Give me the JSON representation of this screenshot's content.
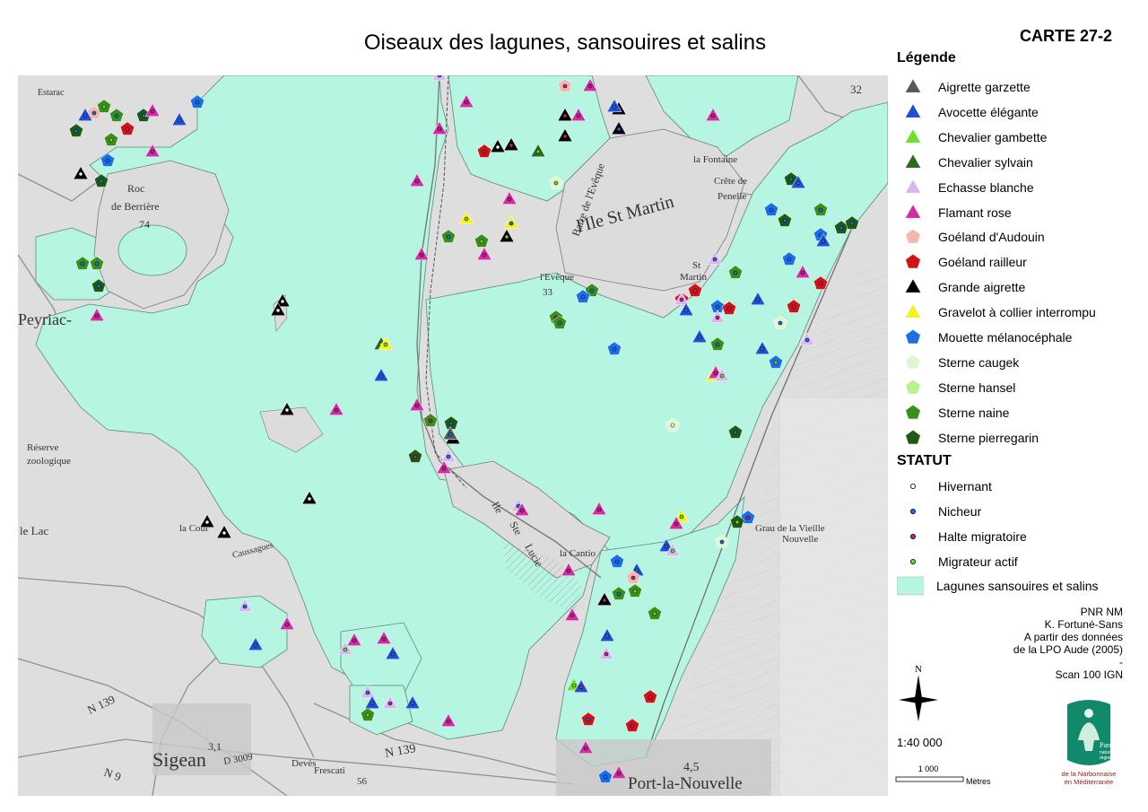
{
  "header": {
    "title": "Oiseaux des lagunes, sansouires et salins",
    "map_id": "CARTE 27-2"
  },
  "colors": {
    "lagoon": "#b5f5e2",
    "land": "#dcdcdc",
    "road": "#8a8a8a"
  },
  "legend": {
    "title": "Légende",
    "species": [
      {
        "label": "Aigrette garzette",
        "shape": "triangle",
        "color": "#595959"
      },
      {
        "label": "Avocette élégante",
        "shape": "triangle",
        "color": "#1f4fd6"
      },
      {
        "label": "Chevalier gambette",
        "shape": "triangle",
        "color": "#6ee028"
      },
      {
        "label": "Chevalier sylvain",
        "shape": "triangle",
        "color": "#2b6a1c"
      },
      {
        "label": "Echasse blanche",
        "shape": "triangle",
        "color": "#d8b6f0"
      },
      {
        "label": "Flamant rose",
        "shape": "triangle",
        "color": "#d02fa4"
      },
      {
        "label": "Goéland d'Audouin",
        "shape": "pentagon",
        "color": "#f2b8b0"
      },
      {
        "label": "Goéland railleur",
        "shape": "pentagon",
        "color": "#d01414"
      },
      {
        "label": "Grande aigrette",
        "shape": "triangle",
        "color": "#000000"
      },
      {
        "label": "Gravelot à collier interrompu",
        "shape": "triangle",
        "color": "#f5f01e"
      },
      {
        "label": "Mouette mélanocéphale",
        "shape": "pentagon",
        "color": "#1a6ee8"
      },
      {
        "label": "Sterne caugek",
        "shape": "pentagon",
        "color": "#dff7cf"
      },
      {
        "label": "Sterne hansel",
        "shape": "pentagon",
        "color": "#b8f28c"
      },
      {
        "label": "Sterne naine",
        "shape": "pentagon",
        "color": "#3a8f1a"
      },
      {
        "label": "Sterne pierregarin",
        "shape": "pentagon",
        "color": "#1f5a14"
      }
    ],
    "status_title": "STATUT",
    "status": [
      {
        "label": "Hivernant",
        "color": "#ffffff"
      },
      {
        "label": "Nicheur",
        "color": "#1a6ee8"
      },
      {
        "label": "Halte migratoire",
        "color": "#c0208a"
      },
      {
        "label": "Migrateur actif",
        "color": "#6ee028"
      }
    ],
    "area_label": "Lagunes sansouires et salins"
  },
  "credits": [
    "PNR NM",
    "K. Fortuné-Sans",
    "A partir des données",
    "de la LPO Aude (2005)",
    "-",
    "Scan 100 IGN"
  ],
  "scale": {
    "ratio": "1:40 000",
    "bar_value": "1 000",
    "bar_unit": "Mètres"
  },
  "north_label": "N",
  "logo": {
    "line1": "Parc",
    "line2": "naturel",
    "line3": "régional",
    "line4": "de la Narbonnaise",
    "line5": "en Méditerranée"
  },
  "place_labels": [
    {
      "text": "Estarac"
    },
    {
      "text": "Roc"
    },
    {
      "text": "de Berrière"
    },
    {
      "text": "74"
    },
    {
      "text": "Peyriac-"
    },
    {
      "text": "Réserve"
    },
    {
      "text": "zoologique"
    },
    {
      "text": "le Lac"
    },
    {
      "text": "la Cour"
    },
    {
      "text": "Caussagues"
    },
    {
      "text": "Sigean"
    },
    {
      "text": "3,1"
    },
    {
      "text": "D 3009"
    },
    {
      "text": "Devès"
    },
    {
      "text": "Frescati"
    },
    {
      "text": "N 139"
    },
    {
      "text": "N 139"
    },
    {
      "text": "N 9"
    },
    {
      "text": "56"
    },
    {
      "text": "Port-la-Nouvelle"
    },
    {
      "text": "4,5"
    },
    {
      "text": "la Fontaine"
    },
    {
      "text": "Crête de"
    },
    {
      "text": "Penelle"
    },
    {
      "text": "l'Ile St Martin"
    },
    {
      "text": "Barre de l'Evêque"
    },
    {
      "text": "l'Evêque"
    },
    {
      "text": "33"
    },
    {
      "text": "St"
    },
    {
      "text": "Martin"
    },
    {
      "text": "32"
    },
    {
      "text": "Ile"
    },
    {
      "text": "Ste"
    },
    {
      "text": "Lucie"
    },
    {
      "text": "la Cantio"
    },
    {
      "text": "Grau de la Vieille"
    },
    {
      "text": "Nouvelle"
    }
  ]
}
